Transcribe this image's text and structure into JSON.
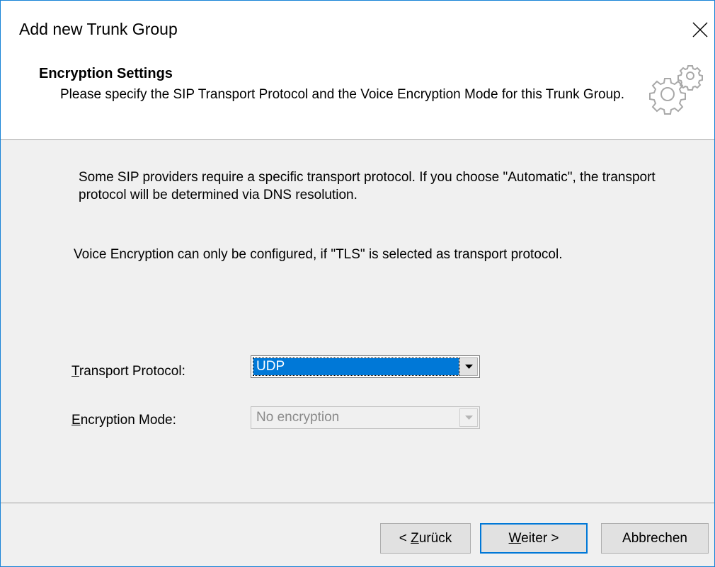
{
  "window": {
    "title": "Add new Trunk Group"
  },
  "header": {
    "title": "Encryption Settings",
    "subtitle": "Please specify the SIP Transport Protocol and the Voice Encryption Mode for this Trunk Group.",
    "icon": "gears-icon"
  },
  "content": {
    "info_text_1": "Some SIP providers require a specific transport protocol. If you choose \"Automatic\", the transport protocol will be determined via DNS resolution.",
    "info_text_2": "Voice Encryption can only be configured, if \"TLS\" is selected as transport protocol.",
    "transport_protocol": {
      "label_mnemonic": "T",
      "label_rest": "ransport Protocol:",
      "value": "UDP"
    },
    "encryption_mode": {
      "label_mnemonic": "E",
      "label_rest": "ncryption Mode:",
      "value": "No encryption",
      "disabled": true
    }
  },
  "buttons": {
    "back_prefix": "< ",
    "back_mnemonic": "Z",
    "back_rest": "urück",
    "next_mnemonic": "W",
    "next_rest": "eiter >",
    "cancel": "Abbrechen"
  },
  "colors": {
    "accent": "#0078d7",
    "window_border": "#1883d7",
    "dialog_bg": "#f0f0f0"
  }
}
